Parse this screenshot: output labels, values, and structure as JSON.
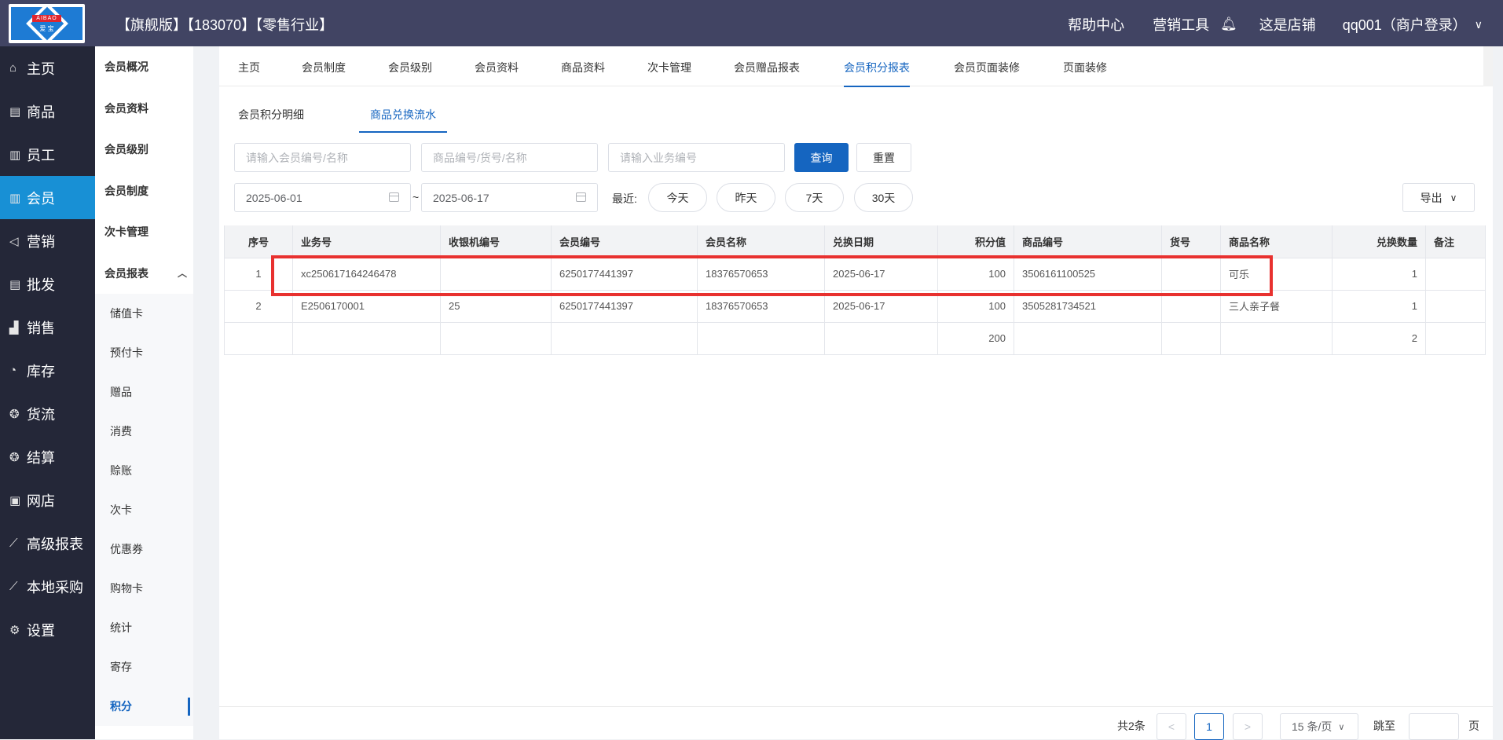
{
  "topbar": {
    "edition": "【旗舰版】【183070】【零售行业】",
    "help": "帮助中心",
    "marketing_tools": "营销工具",
    "my_shop": "这是店铺",
    "user": "qq001（商户登录）",
    "logo_text": "AIBAO",
    "logo_sub": "爱  宝"
  },
  "sidebar": {
    "items": [
      {
        "label": "主页",
        "icon": "home-icon"
      },
      {
        "label": "商品",
        "icon": "goods-icon"
      },
      {
        "label": "员工",
        "icon": "staff-icon"
      },
      {
        "label": "会员",
        "icon": "member-icon"
      },
      {
        "label": "营销",
        "icon": "megaphone-icon"
      },
      {
        "label": "批发",
        "icon": "wholesale-icon"
      },
      {
        "label": "销售",
        "icon": "sales-chart-icon"
      },
      {
        "label": "库存",
        "icon": "pie-icon"
      },
      {
        "label": "货流",
        "icon": "cube-icon"
      },
      {
        "label": "结算",
        "icon": "settle-icon"
      },
      {
        "label": "网店",
        "icon": "gift-icon"
      },
      {
        "label": "高级报表",
        "icon": "line-chart-icon"
      },
      {
        "label": "本地采购",
        "icon": "line-chart-icon"
      },
      {
        "label": "设置",
        "icon": "gear-icon"
      }
    ]
  },
  "subside": {
    "items": [
      "会员概况",
      "会员资料",
      "会员级别",
      "会员制度",
      "次卡管理",
      "会员报表"
    ],
    "children": [
      "储值卡",
      "预付卡",
      "赠品",
      "消费",
      "赊账",
      "次卡",
      "优惠券",
      "购物卡",
      "统计",
      "寄存",
      "积分"
    ]
  },
  "tabs1": [
    "主页",
    "会员制度",
    "会员级别",
    "会员资料",
    "商品资料",
    "次卡管理",
    "会员赠品报表",
    "会员积分报表",
    "会员页面装修",
    "页面装修"
  ],
  "tabs2": [
    "会员积分明细",
    "商品兑换流水"
  ],
  "filters": {
    "member_placeholder": "请输入会员编号/名称",
    "goods_placeholder": "商品编号/货号/名称",
    "biz_placeholder": "请输入业务编号",
    "query": "查询",
    "reset": "重置",
    "date_from": "2025-06-01",
    "date_sep": "~",
    "date_to": "2025-06-17",
    "recent_label": "最近:",
    "today": "今天",
    "yesterday": "昨天",
    "d7": "7天",
    "d30": "30天",
    "export": "导出"
  },
  "table": {
    "headers": [
      "序号",
      "业务号",
      "收银机编号",
      "会员编号",
      "会员名称",
      "兑换日期",
      "积分值",
      "商品编号",
      "货号",
      "商品名称",
      "兑换数量",
      "备注"
    ],
    "rows": [
      [
        "1",
        "xc250617164246478",
        "",
        "6250177441397",
        "18376570653",
        "2025-06-17",
        "100",
        "3506161100525",
        "",
        "可乐",
        "1",
        ""
      ],
      [
        "2",
        "E2506170001",
        "25",
        "6250177441397",
        "18376570653",
        "2025-06-17",
        "100",
        "3505281734521",
        "",
        "三人亲子餐",
        "1",
        ""
      ]
    ],
    "totals": [
      "",
      "",
      "",
      "",
      "",
      "",
      "200",
      "",
      "",
      "",
      "2",
      ""
    ]
  },
  "pager": {
    "total": "共2条",
    "current_page": "1",
    "page_size": "15 条/页",
    "goto": "跳至",
    "page_unit": "页"
  },
  "colors": {
    "topbar": "#414463",
    "sidebar": "#242738",
    "active": "#1890d5",
    "primary": "#1565c0",
    "highlight": "#e8312f"
  }
}
